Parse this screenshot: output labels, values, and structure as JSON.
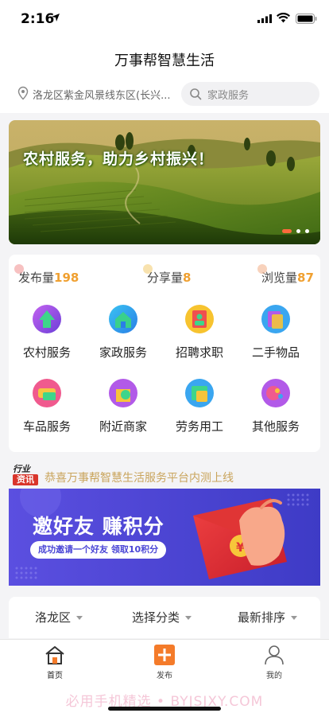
{
  "status": {
    "time": "2:16"
  },
  "header": {
    "title": "万事帮智慧生活"
  },
  "location": {
    "text": "洛龙区紫金风景线东区(长兴..."
  },
  "search": {
    "placeholder": "家政服务"
  },
  "banner": {
    "caption": "农村服务，助力乡村振兴！",
    "slides": 3,
    "active_slide": 1
  },
  "stats": [
    {
      "label": "发布量",
      "value": "198"
    },
    {
      "label": "分享量",
      "value": "8"
    },
    {
      "label": "浏览量",
      "value": "87"
    }
  ],
  "categories": [
    {
      "label": "农村服务",
      "icon": "rural-service-icon"
    },
    {
      "label": "家政服务",
      "icon": "house-service-icon"
    },
    {
      "label": "招聘求职",
      "icon": "recruit-icon"
    },
    {
      "label": "二手物品",
      "icon": "secondhand-icon"
    },
    {
      "label": "车品服务",
      "icon": "car-service-icon"
    },
    {
      "label": "附近商家",
      "icon": "nearby-store-icon"
    },
    {
      "label": "劳务用工",
      "icon": "labor-icon"
    },
    {
      "label": "其他服务",
      "icon": "other-service-icon"
    }
  ],
  "news": {
    "badge_top": "行业",
    "badge_bottom": "资讯",
    "text": "恭喜万事帮智慧生活服务平台内测上线"
  },
  "invite": {
    "title": "邀好友 赚积分",
    "subtitle": "成功邀请一个好友 领取10积分"
  },
  "filters": [
    {
      "label": "洛龙区"
    },
    {
      "label": "选择分类"
    },
    {
      "label": "最新排序"
    }
  ],
  "tabs": [
    {
      "label": "首页",
      "icon": "home-icon"
    },
    {
      "label": "发布",
      "icon": "publish-icon"
    },
    {
      "label": "我的",
      "icon": "profile-icon"
    }
  ],
  "watermark": "必用手机精选 • BYJSJXY.COM",
  "colors": {
    "accent": "#f0a030",
    "publish": "#f47b2a",
    "invite_bg": "#4b45d3",
    "news_text": "#c9a45c"
  }
}
